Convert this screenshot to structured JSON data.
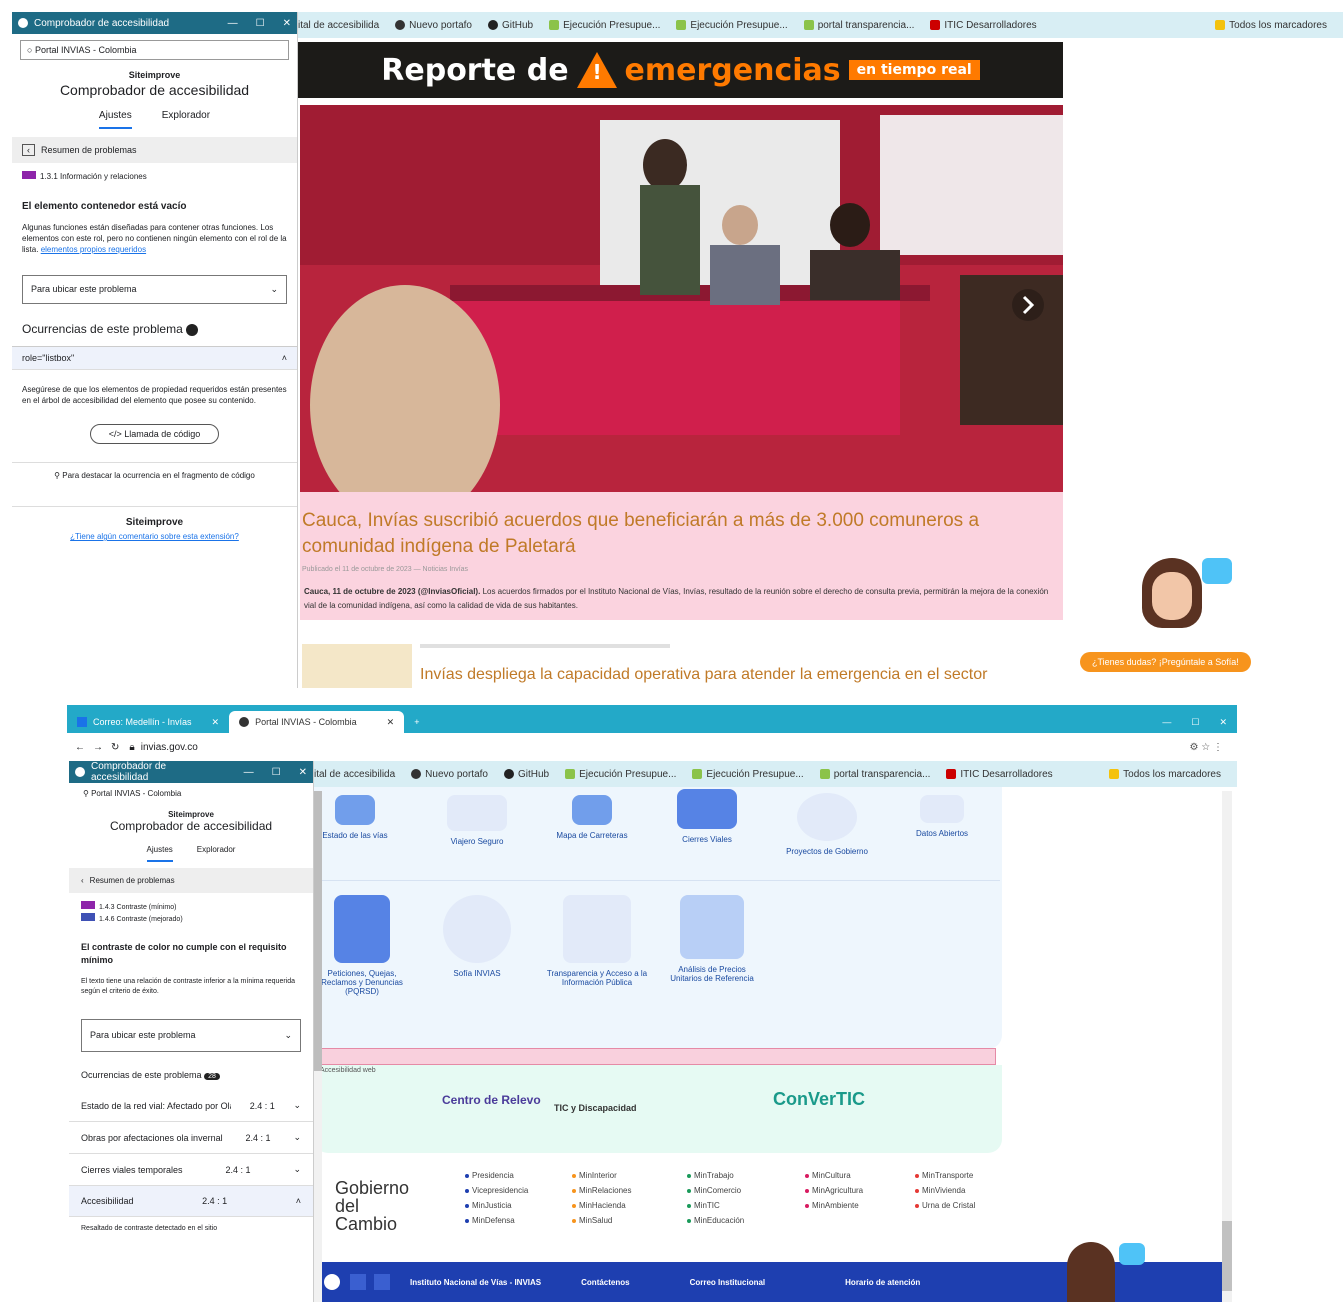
{
  "top": {
    "panel_title": "Comprobador de accesibilidad",
    "url_chip": "Portal INVIAS - Colombia",
    "brand": "Siteimprove",
    "heading": "Comprobador de accesibilidad",
    "tabs": [
      "Ajustes",
      "Explorador"
    ],
    "back_label": "Resumen de problemas",
    "criteria_tag": "1.3.1 Información y relaciones",
    "issue_title": "El elemento contenedor está vacío",
    "issue_text": "Algunas funciones están diseñadas para contener otras funciones. Los elementos con este rol, pero no contienen ningún elemento con el rol de la lista.",
    "issue_link": "elementos propios requeridos",
    "select_label": "Para ubicar este problema",
    "occurrences_label": "Ocurrencias de este problema",
    "rule_header": "role=\"listbox\"",
    "rule_text": "Asegúrese de que los elementos de propiedad requeridos están presentes en el árbol de accesibilidad del elemento que posee su contenido.",
    "code_button": "Llamada de código",
    "tip_text": "Para destacar la ocurrencia en el fragmento de código",
    "foot_brand": "Siteimprove",
    "foot_text": "¿Tiene algún comentario sobre esta extensión?"
  },
  "bookmarks": [
    "ital de accesibilida",
    "Nuevo portafo",
    "GitHub",
    "Ejecución Presupue...",
    "Ejecución Presupue...",
    "portal transparencia...",
    "ITIC Desarrolladores"
  ],
  "bookmarks_right": "Todos los marcadores",
  "banner": {
    "part1": "Reporte de",
    "part2": "emergencias",
    "badge": "en tiempo real"
  },
  "news": {
    "title": "Cauca, Invías suscribió acuerdos que beneficiarán a más de 3.000 comuneros a comunidad indígena de Paletará",
    "meta": "Publicado el 11 de octubre de 2023 — Noticias Invías",
    "lead_bold": "Cauca, 11 de octubre de 2023 (@InviasOficial).",
    "lead": "Los acuerdos firmados por el Instituto Nacional de Vías, Invías, resultado de la reunión sobre el derecho de consulta previa, permitirán la mejora de la conexión vial de la comunidad indígena, así como la calidad de vida de sus habitantes.",
    "next_title": "Invías despliega la capacidad operativa para atender la emergencia en el sector"
  },
  "assist_pill": "¿Tienes dudas? ¡Pregúntale a Sofía!",
  "bottom": {
    "tabs": [
      "Correo: Medellín - Invías",
      "Portal INVIAS - Colombia"
    ],
    "address": "invias.gov.co",
    "panel_title": "Comprobador de accesibilidad",
    "url_chip": "Portal INVIAS - Colombia",
    "brand": "Siteimprove",
    "heading": "Comprobador de accesibilidad",
    "tabs_panel": [
      "Ajustes",
      "Explorador"
    ],
    "back_label": "Resumen de problemas",
    "criteria": [
      "1.4.3 Contraste (mínimo)",
      "1.4.6 Contraste (mejorado)"
    ],
    "issue_title": "El contraste de color no cumple con el requisito mínimo",
    "issue_text": "El texto tiene una relación de contraste inferior a la mínima requerida según el criterio de éxito.",
    "select_label": "Para ubicar este problema",
    "occurrences_label": "Ocurrencias de este problema",
    "occurrences_count": "28",
    "occ_rows": [
      {
        "label": "Estado de la red vial: Afectado por Ola Invernal",
        "ratio": "2.4 : 1"
      },
      {
        "label": "Obras por afectaciones ola invernal",
        "ratio": "2.4 : 1"
      },
      {
        "label": "Cierres viales temporales",
        "ratio": "2.4 : 1"
      },
      {
        "label": "Accesibilidad",
        "ratio": "2.4 : 1"
      }
    ],
    "occ_sub": "Resaltado de contraste detectado en el sitio",
    "services_row1": [
      "Estado de las vías",
      "Viajero Seguro",
      "Mapa de Carreteras",
      "Cierres Viales",
      "Proyectos de Gobierno",
      "Datos Abiertos"
    ],
    "services_row2": [
      "Peticiones, Quejas, Reclamos y Denuncias (PQRSD)",
      "Sofía INVIAS",
      "Transparencia y Acceso a la Información Pública",
      "Análisis de Precios Unitarios de Referencia"
    ],
    "small_label": "Accesibilidad web",
    "logos": [
      "Centro de Relevo",
      "TIC y Discapacidad",
      "ConVerTIC"
    ],
    "gov": "Gobierno del Cambio",
    "links": [
      [
        "Presidencia",
        "Vicepresidencia",
        "MinJusticia",
        "MinDefensa"
      ],
      [
        "MinInterior",
        "MinRelaciones",
        "MinHacienda",
        "MinSalud"
      ],
      [
        "MinTrabajo",
        "MinComercio",
        "MinTIC",
        "MinEducación"
      ],
      [
        "MinCultura",
        "MinAgricultura",
        "MinAmbiente"
      ],
      [
        "MinTransporte",
        "MinVivienda",
        "Urna de Cristal"
      ]
    ],
    "footer": [
      "Instituto Nacional de Vías - INVIAS",
      "Contáctenos",
      "Correo Institucional",
      "Horario de atención"
    ]
  },
  "colors": {
    "accent": "#23a9c8",
    "orange": "#ff7a00",
    "news": "#c07a28",
    "footer": "#1e3fb0"
  }
}
